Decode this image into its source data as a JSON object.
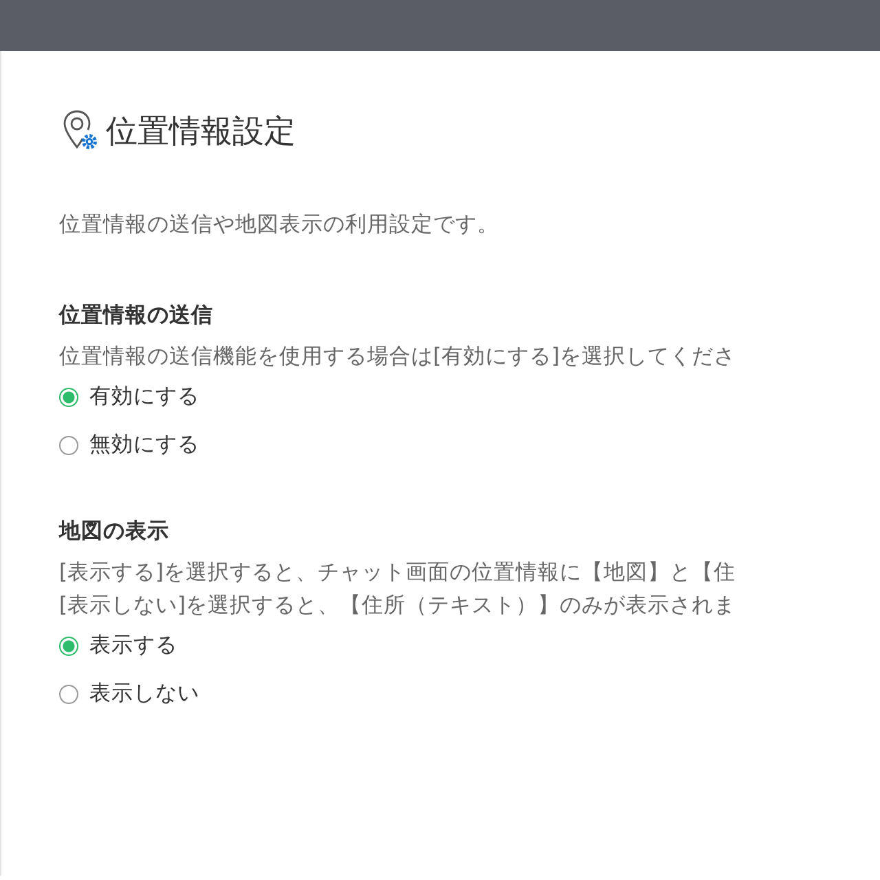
{
  "page": {
    "title": "位置情報設定",
    "description": "位置情報の送信や地図表示の利用設定です。"
  },
  "sections": [
    {
      "title": "位置情報の送信",
      "description": [
        "位置情報の送信機能を使用する場合は[有効にする]を選択してくださ"
      ],
      "options": [
        {
          "label": "有効にする",
          "selected": true
        },
        {
          "label": "無効にする",
          "selected": false
        }
      ]
    },
    {
      "title": "地図の表示",
      "description": [
        "[表示する]を選択すると、チャット画面の位置情報に【地図】と【住",
        "[表示しない]を選択すると、【住所（テキスト）】のみが表示されま"
      ],
      "options": [
        {
          "label": "表示する",
          "selected": true
        },
        {
          "label": "表示しない",
          "selected": false
        }
      ]
    }
  ]
}
